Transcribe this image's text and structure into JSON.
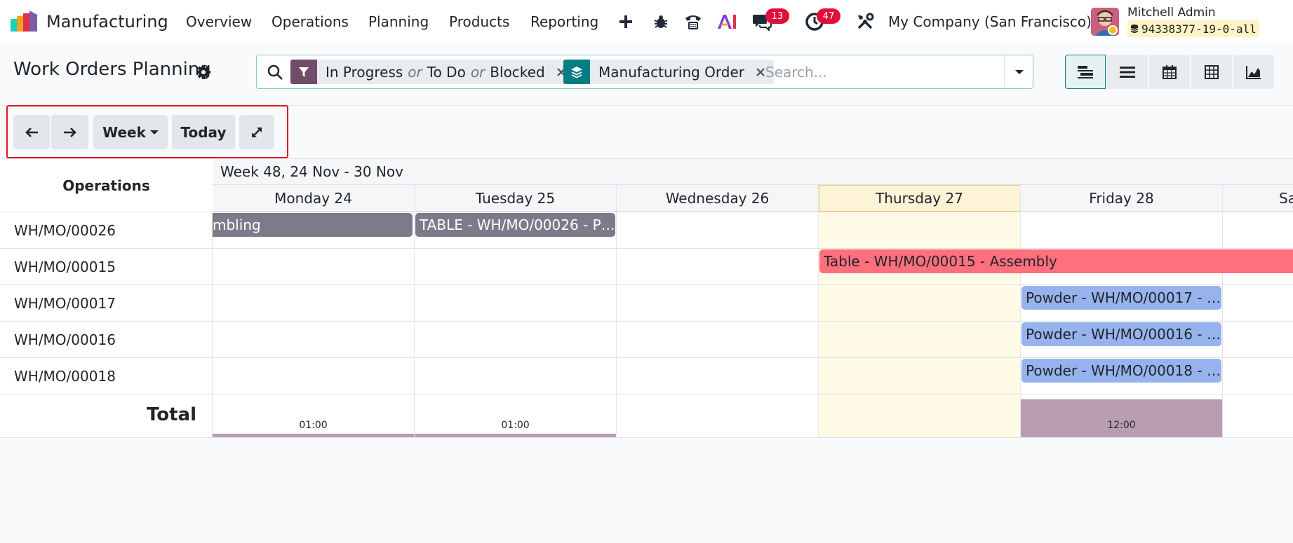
{
  "navbar": {
    "app_name": "Manufacturing",
    "menu": [
      "Overview",
      "Operations",
      "Planning",
      "Products",
      "Reporting"
    ],
    "messages_count": "13",
    "activities_count": "47",
    "company": "My Company (San Francisco)",
    "user_name": "Mitchell Admin",
    "database": "94338377-19-0-all"
  },
  "control_panel": {
    "title": "Work Orders Planning",
    "search_placeholder": "Search...",
    "filter_facet": {
      "values": [
        "In Progress",
        "To Do",
        "Blocked"
      ],
      "separator": "or"
    },
    "groupby_facet": {
      "value": "Manufacturing Order"
    },
    "views": [
      "gantt",
      "list",
      "calendar",
      "pivot",
      "graph"
    ]
  },
  "gantt_toolbar": {
    "scale_label": "Week",
    "today_label": "Today"
  },
  "gantt": {
    "rows_header": "Operations",
    "week_label": "Week 48, 24 Nov - 30 Nov",
    "days": [
      "Monday 24",
      "Tuesday 25",
      "Wednesday 26",
      "Thursday 27",
      "Friday 28",
      "Sa"
    ],
    "today_day": "Thursday 27",
    "rows": [
      {
        "label": "WH/MO/00026",
        "pills": [
          {
            "text": "mbling",
            "color": "gray"
          },
          {
            "text": "TABLE - WH/MO/00026 - P…",
            "color": "gray"
          }
        ]
      },
      {
        "label": "WH/MO/00015",
        "pills": [
          {
            "text": "Table - WH/MO/00015 - Assembly",
            "color": "red"
          }
        ]
      },
      {
        "label": "WH/MO/00017",
        "pills": [
          {
            "text": "Powder - WH/MO/00017 - …",
            "color": "blue"
          }
        ]
      },
      {
        "label": "WH/MO/00016",
        "pills": [
          {
            "text": "Powder - WH/MO/00016 - …",
            "color": "blue"
          }
        ]
      },
      {
        "label": "WH/MO/00018",
        "pills": [
          {
            "text": "Powder - WH/MO/00018 - …",
            "color": "blue"
          }
        ]
      }
    ],
    "total_label": "Total",
    "totals": [
      "01:00",
      "01:00",
      "12:00"
    ]
  },
  "colors": {
    "brand": "#714b67",
    "accent": "#017e84",
    "gray_pill": "#7c7b89",
    "red_pill": "#ff6f7d",
    "blue_pill": "#97b3ee",
    "today_bg": "#fffbe6",
    "total_bar": "#b99eb2",
    "badge": "#e0103a"
  }
}
